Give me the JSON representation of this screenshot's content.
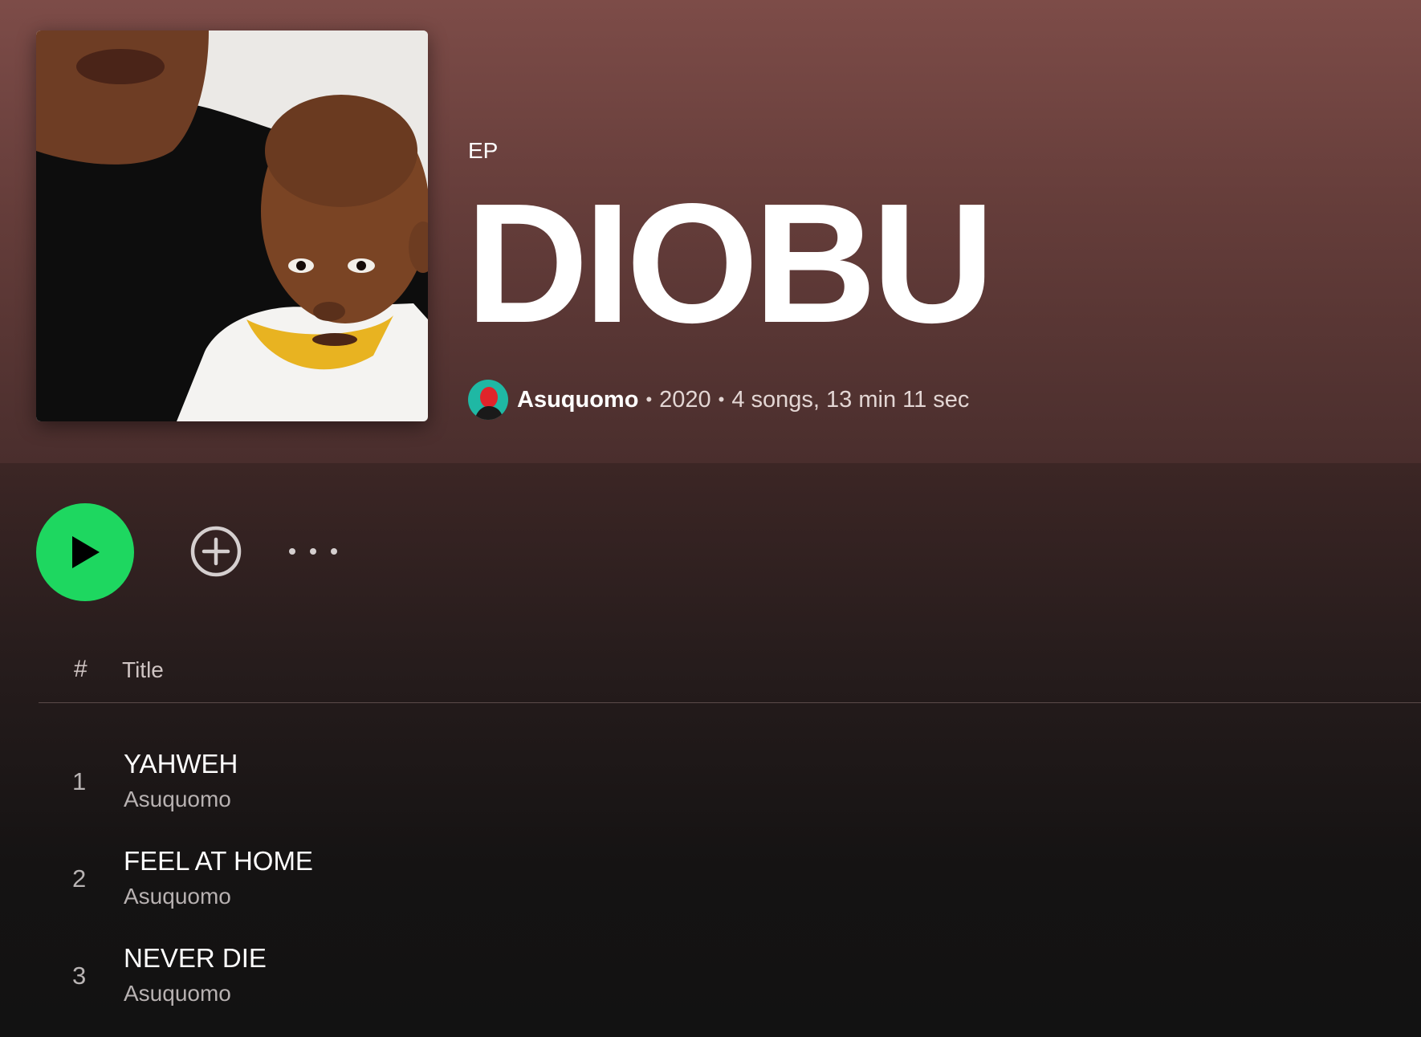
{
  "album": {
    "type": "EP",
    "title": "DIOBU",
    "artist": "Asuquomo",
    "year": "2020",
    "summary": "4 songs, 13 min 11 sec",
    "separator": "•"
  },
  "icons": {
    "play": "play-icon",
    "add": "add-circle-icon",
    "more": "more-horizontal-icon"
  },
  "colors": {
    "accent": "#1ed760",
    "header_gradient_top": "#7d4c48",
    "background": "#121212"
  },
  "table": {
    "headers": {
      "number": "#",
      "title": "Title"
    },
    "tracks": [
      {
        "number": "1",
        "title": "YAHWEH",
        "artist": "Asuquomo"
      },
      {
        "number": "2",
        "title": "FEEL AT HOME",
        "artist": "Asuquomo"
      },
      {
        "number": "3",
        "title": "NEVER DIE",
        "artist": "Asuquomo"
      }
    ]
  }
}
